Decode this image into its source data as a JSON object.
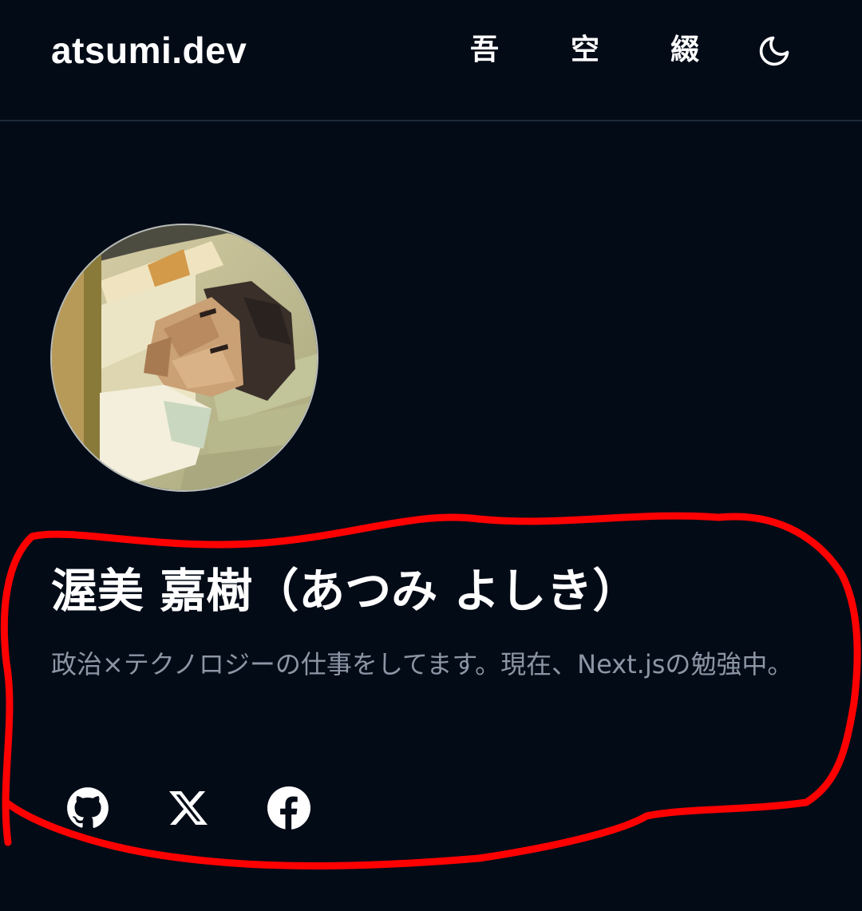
{
  "header": {
    "site_title": "atsumi.dev",
    "nav": [
      {
        "label": "吾"
      },
      {
        "label": "空"
      },
      {
        "label": "綴"
      }
    ],
    "theme_toggle_icon": "moon-icon"
  },
  "profile": {
    "name": "渥美 嘉樹（あつみ よしき）",
    "bio": "政治×テクノロジーの仕事をしてます。現在、Next.jsの勉強中。",
    "social": [
      {
        "icon": "github-icon"
      },
      {
        "icon": "x-icon"
      },
      {
        "icon": "facebook-icon"
      }
    ]
  },
  "colors": {
    "background": "#030b17",
    "text": "#ffffff",
    "muted_text": "#8c96a4",
    "divider": "#1e2b3a",
    "annotation": "#ff0000"
  }
}
